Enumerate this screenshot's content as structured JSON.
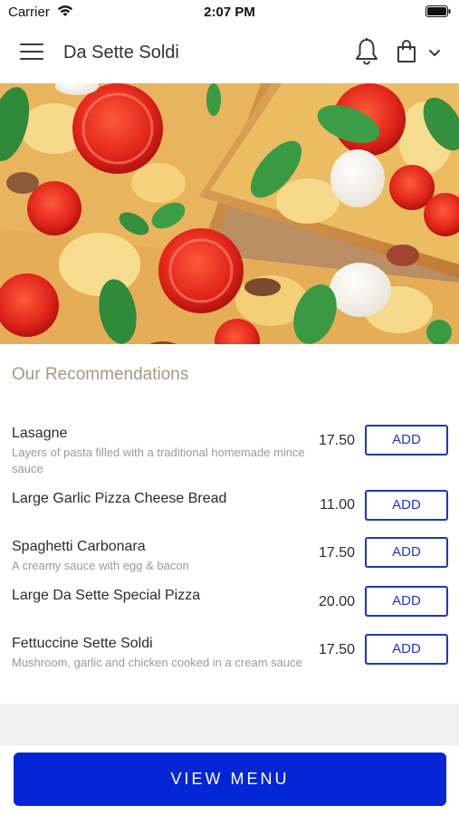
{
  "status_bar": {
    "carrier": "Carrier",
    "time": "2:07 PM"
  },
  "header": {
    "title": "Da Sette Soldi",
    "icons": [
      "hamburger-menu-icon",
      "bell-icon",
      "shopping-bag-icon",
      "chevron-down-icon"
    ]
  },
  "hero": {
    "icon": "pizza-hero-image"
  },
  "recommendations": {
    "title": "Our Recommendations",
    "items": [
      {
        "name": "Lasagne",
        "description": "Layers of pasta filled with a traditional homemade mince sauce",
        "price": "17.50",
        "button": "ADD"
      },
      {
        "name": "Large Garlic Pizza Cheese Bread",
        "description": "",
        "price": "11.00",
        "button": "ADD"
      },
      {
        "name": "Spaghetti Carbonara",
        "description": "A creamy sauce with egg & bacon",
        "price": "17.50",
        "button": "ADD"
      },
      {
        "name": "Large Da Sette Special Pizza",
        "description": "",
        "price": "20.00",
        "button": "ADD"
      },
      {
        "name": "Fettuccine Sette Soldi",
        "description": "Mushroom, garlic and chicken cooked in a cream sauce",
        "price": "17.50",
        "button": "ADD"
      }
    ]
  },
  "footer": {
    "view_menu_label": "VIEW MENU"
  },
  "colors": {
    "accent": "#0226d6",
    "button_border": "#1a37c6",
    "section_title": "#a29a82"
  }
}
